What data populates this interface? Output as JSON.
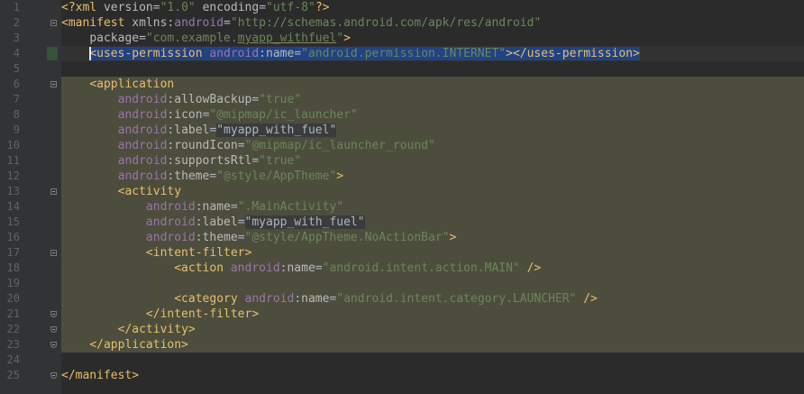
{
  "editor": {
    "language": "xml",
    "caret_line": 4,
    "lines": [
      {
        "n": "1",
        "segments": [
          {
            "t": "<?xml ",
            "c": "t"
          },
          {
            "t": "version",
            "c": "a"
          },
          {
            "t": "=",
            "c": "p"
          },
          {
            "t": "\"1.0\"",
            "c": "v"
          },
          {
            "t": " ",
            "c": "p"
          },
          {
            "t": "encoding",
            "c": "a"
          },
          {
            "t": "=",
            "c": "p"
          },
          {
            "t": "\"utf-8\"",
            "c": "v"
          },
          {
            "t": "?>",
            "c": "t"
          }
        ]
      },
      {
        "n": "2",
        "segments": [
          {
            "t": "<manifest ",
            "c": "t"
          },
          {
            "t": "xmlns:",
            "c": "a"
          },
          {
            "t": "android",
            "c": "ns"
          },
          {
            "t": "=",
            "c": "p"
          },
          {
            "t": "\"http://schemas.android.com/apk/res/android\"",
            "c": "v"
          }
        ]
      },
      {
        "n": "3",
        "segments": [
          {
            "t": "    ",
            "c": "p"
          },
          {
            "t": "package",
            "c": "a"
          },
          {
            "t": "=",
            "c": "p"
          },
          {
            "t": "\"com.example.",
            "c": "v"
          },
          {
            "t": "myapp_withfuel",
            "c": "v ul"
          },
          {
            "t": "\"",
            "c": "v"
          },
          {
            "t": ">",
            "c": "t"
          }
        ]
      },
      {
        "n": "4",
        "segments": [
          {
            "t": "    ",
            "c": "p"
          },
          {
            "t": "<uses-permission ",
            "c": "t sel"
          },
          {
            "t": "android",
            "c": "ns sel"
          },
          {
            "t": ":name",
            "c": "a sel"
          },
          {
            "t": "=",
            "c": "p sel"
          },
          {
            "t": "\"android.permission.INTERNET\"",
            "c": "v sel"
          },
          {
            "t": "></uses-permission>",
            "c": "t sel"
          }
        ]
      },
      {
        "n": "5",
        "segments": []
      },
      {
        "n": "6",
        "segments": [
          {
            "t": "    ",
            "c": "p"
          },
          {
            "t": "<application",
            "c": "t"
          }
        ]
      },
      {
        "n": "7",
        "segments": [
          {
            "t": "        ",
            "c": "p"
          },
          {
            "t": "android",
            "c": "ns"
          },
          {
            "t": ":allowBackup",
            "c": "a"
          },
          {
            "t": "=",
            "c": "p"
          },
          {
            "t": "\"true\"",
            "c": "v"
          }
        ]
      },
      {
        "n": "8",
        "segments": [
          {
            "t": "        ",
            "c": "p"
          },
          {
            "t": "android",
            "c": "ns"
          },
          {
            "t": ":icon",
            "c": "a"
          },
          {
            "t": "=",
            "c": "p"
          },
          {
            "t": "\"@mipmap/ic_launcher\"",
            "c": "v"
          }
        ]
      },
      {
        "n": "9",
        "segments": [
          {
            "t": "        ",
            "c": "p"
          },
          {
            "t": "android",
            "c": "ns"
          },
          {
            "t": ":label",
            "c": "a"
          },
          {
            "t": "=",
            "c": "p"
          },
          {
            "t": "\"myapp_with_fuel\"",
            "c": "p lab"
          }
        ]
      },
      {
        "n": "10",
        "segments": [
          {
            "t": "        ",
            "c": "p"
          },
          {
            "t": "android",
            "c": "ns"
          },
          {
            "t": ":roundIcon",
            "c": "a"
          },
          {
            "t": "=",
            "c": "p"
          },
          {
            "t": "\"@mipmap/ic_launcher_round\"",
            "c": "v"
          }
        ]
      },
      {
        "n": "11",
        "segments": [
          {
            "t": "        ",
            "c": "p"
          },
          {
            "t": "android",
            "c": "ns"
          },
          {
            "t": ":supportsRtl",
            "c": "a"
          },
          {
            "t": "=",
            "c": "p"
          },
          {
            "t": "\"true\"",
            "c": "v"
          }
        ]
      },
      {
        "n": "12",
        "segments": [
          {
            "t": "        ",
            "c": "p"
          },
          {
            "t": "android",
            "c": "ns"
          },
          {
            "t": ":theme",
            "c": "a"
          },
          {
            "t": "=",
            "c": "p"
          },
          {
            "t": "\"@style/AppTheme\"",
            "c": "v"
          },
          {
            "t": ">",
            "c": "t"
          }
        ]
      },
      {
        "n": "13",
        "segments": [
          {
            "t": "        ",
            "c": "p"
          },
          {
            "t": "<activity",
            "c": "t"
          }
        ]
      },
      {
        "n": "14",
        "segments": [
          {
            "t": "            ",
            "c": "p"
          },
          {
            "t": "android",
            "c": "ns"
          },
          {
            "t": ":name",
            "c": "a"
          },
          {
            "t": "=",
            "c": "p"
          },
          {
            "t": "\".MainActivity\"",
            "c": "v"
          }
        ]
      },
      {
        "n": "15",
        "segments": [
          {
            "t": "            ",
            "c": "p"
          },
          {
            "t": "android",
            "c": "ns"
          },
          {
            "t": ":label",
            "c": "a"
          },
          {
            "t": "=",
            "c": "p"
          },
          {
            "t": "\"myapp_with_fuel\"",
            "c": "p lab"
          }
        ]
      },
      {
        "n": "16",
        "segments": [
          {
            "t": "            ",
            "c": "p"
          },
          {
            "t": "android",
            "c": "ns"
          },
          {
            "t": ":theme",
            "c": "a"
          },
          {
            "t": "=",
            "c": "p"
          },
          {
            "t": "\"@style/AppTheme.NoActionBar\"",
            "c": "v"
          },
          {
            "t": ">",
            "c": "t"
          }
        ]
      },
      {
        "n": "17",
        "segments": [
          {
            "t": "            ",
            "c": "p"
          },
          {
            "t": "<intent-filter>",
            "c": "t"
          }
        ]
      },
      {
        "n": "18",
        "segments": [
          {
            "t": "                ",
            "c": "p"
          },
          {
            "t": "<action ",
            "c": "t"
          },
          {
            "t": "android",
            "c": "ns"
          },
          {
            "t": ":name",
            "c": "a"
          },
          {
            "t": "=",
            "c": "p"
          },
          {
            "t": "\"android.intent.action.MAIN\"",
            "c": "v"
          },
          {
            "t": " />",
            "c": "t"
          }
        ]
      },
      {
        "n": "19",
        "segments": []
      },
      {
        "n": "20",
        "segments": [
          {
            "t": "                ",
            "c": "p"
          },
          {
            "t": "<category ",
            "c": "t"
          },
          {
            "t": "android",
            "c": "ns"
          },
          {
            "t": ":name",
            "c": "a"
          },
          {
            "t": "=",
            "c": "p"
          },
          {
            "t": "\"android.intent.category.LAUNCHER\"",
            "c": "v"
          },
          {
            "t": " />",
            "c": "t"
          }
        ]
      },
      {
        "n": "21",
        "segments": [
          {
            "t": "            ",
            "c": "p"
          },
          {
            "t": "</intent-filter>",
            "c": "t"
          }
        ]
      },
      {
        "n": "22",
        "segments": [
          {
            "t": "        ",
            "c": "p"
          },
          {
            "t": "</activity>",
            "c": "t"
          }
        ]
      },
      {
        "n": "23",
        "segments": [
          {
            "t": "    ",
            "c": "p"
          },
          {
            "t": "</application>",
            "c": "t"
          }
        ]
      },
      {
        "n": "24",
        "segments": []
      },
      {
        "n": "25",
        "segments": [
          {
            "t": "</manifest>",
            "c": "t"
          }
        ]
      }
    ],
    "fold_markers": [
      {
        "line": 2,
        "kind": "start"
      },
      {
        "line": 6,
        "kind": "start"
      },
      {
        "line": 13,
        "kind": "start"
      },
      {
        "line": 17,
        "kind": "start"
      },
      {
        "line": 21,
        "kind": "end"
      },
      {
        "line": 22,
        "kind": "end"
      },
      {
        "line": 23,
        "kind": "end"
      },
      {
        "line": 25,
        "kind": "end"
      }
    ]
  }
}
